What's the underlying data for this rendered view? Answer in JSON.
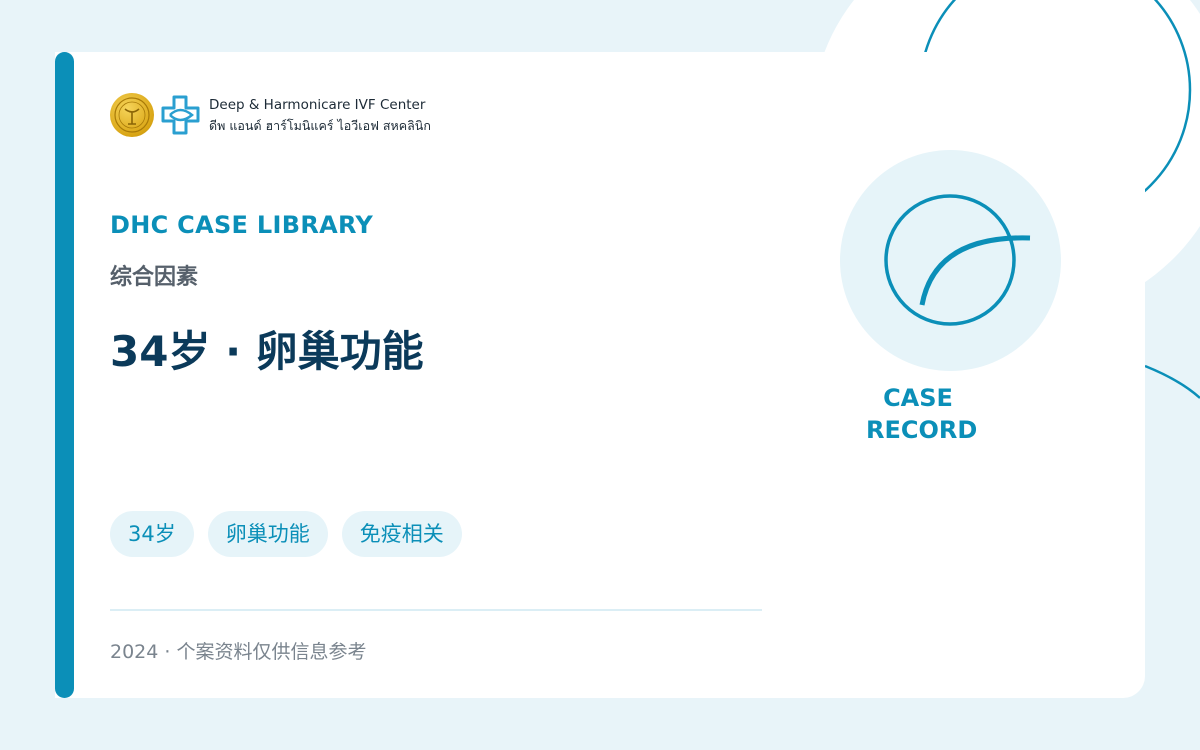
{
  "logo": {
    "name_en": "Deep & Harmonicare IVF Center",
    "name_th": "ดีพ แอนด์ ฮาร์โมนิแคร์ ไอวีเอฟ สหคลินิก"
  },
  "library_label": "DHC CASE LIBRARY",
  "category": "综合因素",
  "title": "34岁 · 卵巢功能",
  "tags": [
    {
      "label": "34岁"
    },
    {
      "label": "卵巢功能"
    },
    {
      "label": "免疫相关"
    }
  ],
  "footer": "2024 · 个案资料仅供信息参考",
  "case_badge": {
    "line1": "CASE",
    "line2": "RECORD"
  },
  "colors": {
    "accent": "#0b8fb8",
    "title": "#0b3a5a",
    "background": "#e8f4f9",
    "tag_bg": "#e6f4f9"
  },
  "icons": {
    "seal": "gold-seal-icon",
    "brand": "medical-cross-icon",
    "badge": "circle-arc-icon"
  }
}
